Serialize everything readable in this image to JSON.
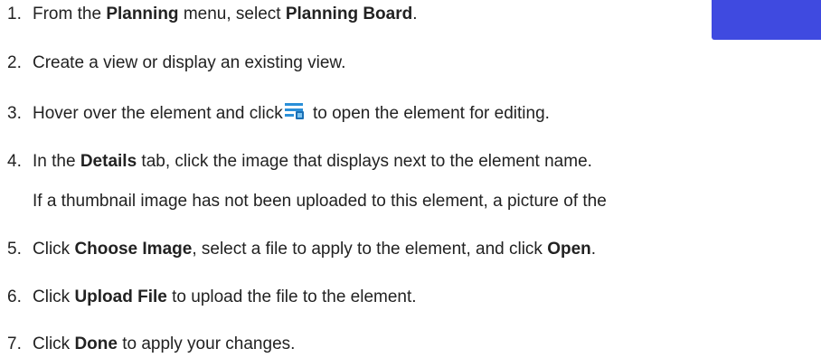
{
  "decoration": {
    "box_color": "#3f4ae0"
  },
  "steps": [
    {
      "num": "1.",
      "pre": "From the ",
      "b1": "Planning",
      "mid": " menu, select ",
      "b2": "Planning Board",
      "post": "."
    },
    {
      "num": "2.",
      "text": "Create a view or display an existing view."
    },
    {
      "num": "3.",
      "pre": "Hover over the element and click",
      "post": " to open the element for editing.",
      "icon": "edit-list-icon"
    },
    {
      "num": "4.",
      "pre": "In the ",
      "b1": "Details",
      "post": " tab, click the image that displays next to the element name."
    },
    {
      "note": "If a thumbnail image has not been uploaded to this element, a picture of the"
    },
    {
      "num": "5.",
      "pre": "Click ",
      "b1": "Choose Image",
      "mid": ", select a file to apply to the element, and click ",
      "b2": "Open",
      "post": "."
    },
    {
      "num": "6.",
      "pre": "Click ",
      "b1": "Upload File",
      "post": " to upload the file to the element."
    },
    {
      "num": "7.",
      "pre": "Click ",
      "b1": "Done",
      "post": " to apply your changes."
    }
  ]
}
